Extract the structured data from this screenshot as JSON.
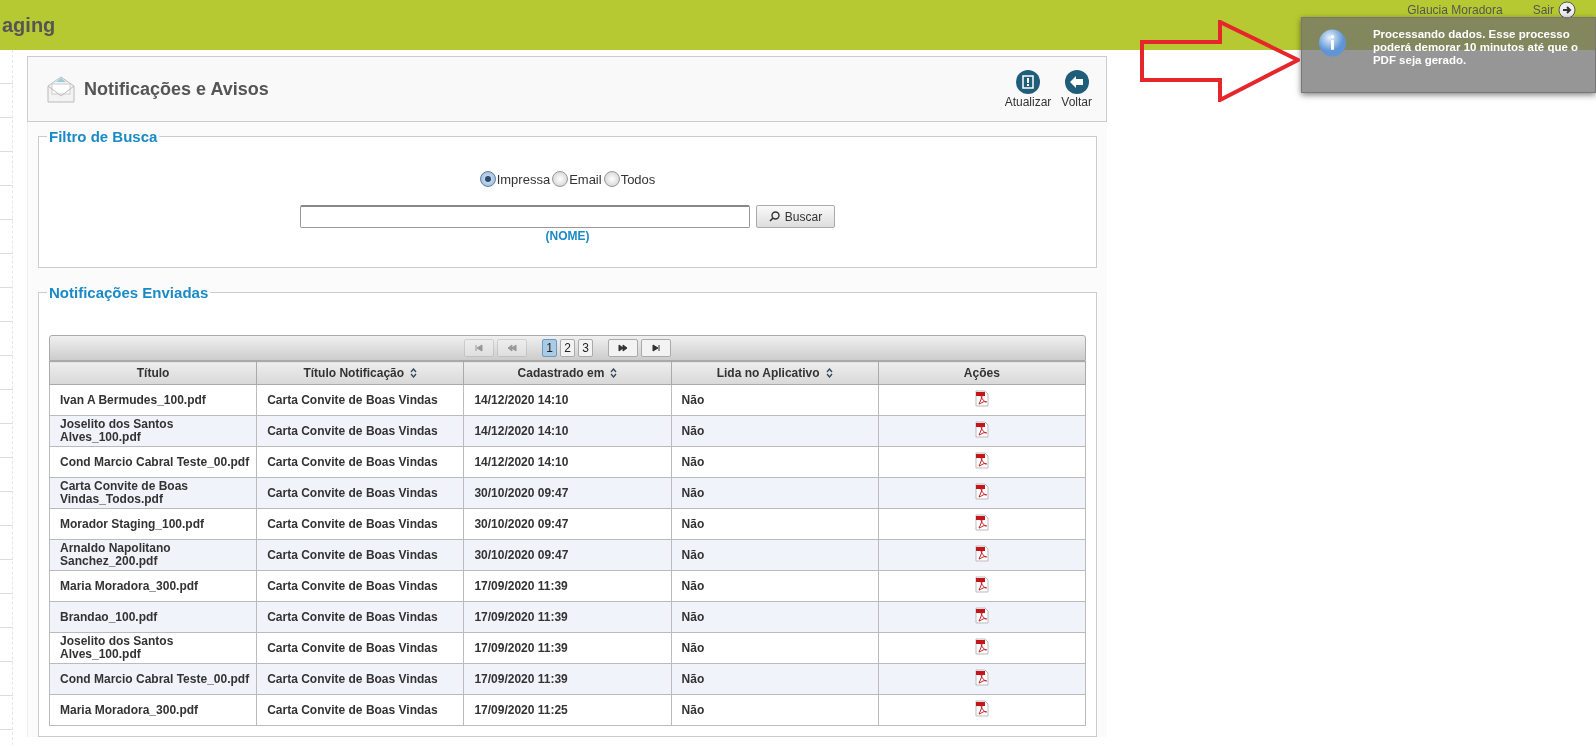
{
  "topbar": {
    "title": "aging",
    "user": "Glaucia Moradora",
    "logout": "Sair"
  },
  "header": {
    "title": "Notificações e Avisos",
    "actions": [
      {
        "kind": "refresh",
        "label": "Atualizar"
      },
      {
        "kind": "back",
        "label": "Voltar"
      }
    ]
  },
  "filter": {
    "legend": "Filtro de Busca",
    "options": [
      {
        "label": "Impressa",
        "selected": true
      },
      {
        "label": "Email",
        "selected": false
      },
      {
        "label": "Todos",
        "selected": false
      }
    ],
    "search_button": "Buscar",
    "hint": "(NOME)"
  },
  "sent": {
    "legend": "Notificações Enviadas",
    "pager": {
      "pages": [
        {
          "label": "1",
          "selected": true
        },
        {
          "label": "2",
          "selected": false
        },
        {
          "label": "3",
          "selected": false
        }
      ],
      "first_disabled": true,
      "prev_disabled": true,
      "next_disabled": false,
      "last_disabled": false
    },
    "columns": [
      {
        "label": "Título",
        "sortable": false
      },
      {
        "label": "Título Notificação",
        "sortable": true
      },
      {
        "label": "Cadastrado em",
        "sortable": true
      },
      {
        "label": "Lida no Aplicativo",
        "sortable": true
      },
      {
        "label": "Ações",
        "sortable": false
      }
    ],
    "rows": [
      {
        "title": "Ivan A Bermudes_100.pdf",
        "notification": "Carta Convite de Boas Vindas",
        "date": "14/12/2020 14:10",
        "read": "Não"
      },
      {
        "title": "Joselito dos Santos Alves_100.pdf",
        "notification": "Carta Convite de Boas Vindas",
        "date": "14/12/2020 14:10",
        "read": "Não"
      },
      {
        "title": "Cond Marcio Cabral Teste_00.pdf",
        "notification": "Carta Convite de Boas Vindas",
        "date": "14/12/2020 14:10",
        "read": "Não"
      },
      {
        "title": "Carta Convite de Boas Vindas_Todos.pdf",
        "notification": "Carta Convite de Boas Vindas",
        "date": "30/10/2020 09:47",
        "read": "Não"
      },
      {
        "title": "Morador Staging_100.pdf",
        "notification": "Carta Convite de Boas Vindas",
        "date": "30/10/2020 09:47",
        "read": "Não"
      },
      {
        "title": "Arnaldo Napolitano Sanchez_200.pdf",
        "notification": "Carta Convite de Boas Vindas",
        "date": "30/10/2020 09:47",
        "read": "Não"
      },
      {
        "title": "Maria Moradora_300.pdf",
        "notification": "Carta Convite de Boas Vindas",
        "date": "17/09/2020 11:39",
        "read": "Não"
      },
      {
        "title": "Brandao_100.pdf",
        "notification": "Carta Convite de Boas Vindas",
        "date": "17/09/2020 11:39",
        "read": "Não"
      },
      {
        "title": "Joselito dos Santos Alves_100.pdf",
        "notification": "Carta Convite de Boas Vindas",
        "date": "17/09/2020 11:39",
        "read": "Não"
      },
      {
        "title": "Cond Marcio Cabral Teste_00.pdf",
        "notification": "Carta Convite de Boas Vindas",
        "date": "17/09/2020 11:39",
        "read": "Não"
      },
      {
        "title": "Maria Moradora_300.pdf",
        "notification": "Carta Convite de Boas Vindas",
        "date": "17/09/2020 11:25",
        "read": "Não"
      }
    ]
  },
  "toast": {
    "message": "Processando dados. Esse processo poderá demorar 10 minutos até que o PDF seja gerado."
  }
}
